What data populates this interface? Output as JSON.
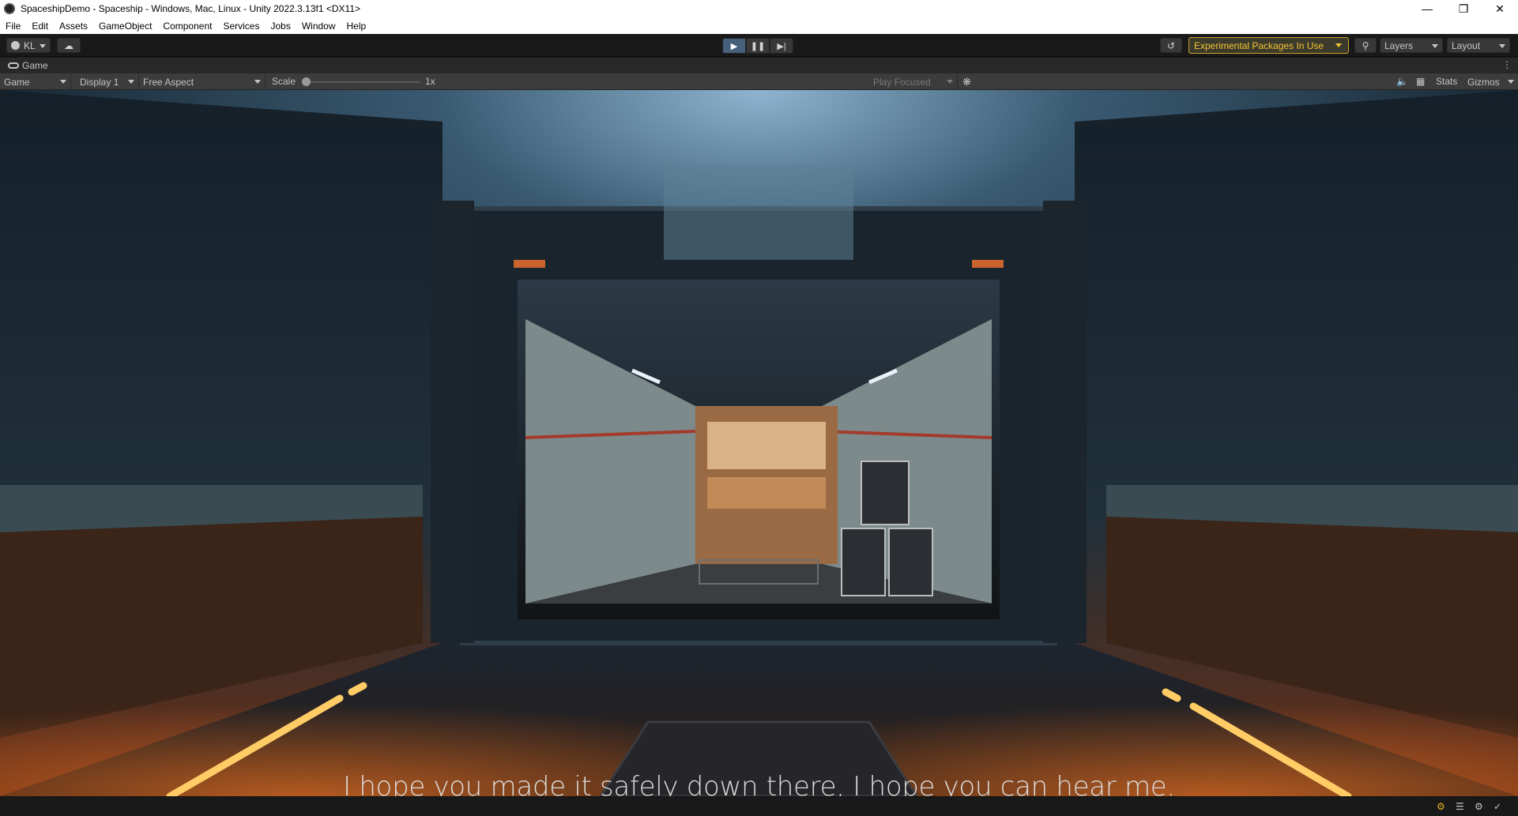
{
  "window": {
    "title": "SpaceshipDemo - Spaceship - Windows, Mac, Linux - Unity 2022.3.13f1 <DX11>",
    "controls": [
      "minimize",
      "restore",
      "close"
    ]
  },
  "menu": [
    "File",
    "Edit",
    "Assets",
    "GameObject",
    "Component",
    "Services",
    "Jobs",
    "Window",
    "Help"
  ],
  "toolbar": {
    "account_label": "KL",
    "experimental_label": "Experimental Packages In Use",
    "layers_label": "Layers",
    "layout_label": "Layout",
    "play_state": "playing"
  },
  "tab": {
    "label": "Game"
  },
  "game_toolbar": {
    "mode": "Game",
    "display": "Display 1",
    "aspect": "Free Aspect",
    "scale_label": "Scale",
    "scale_value": "1x",
    "play_mode": "Play Focused",
    "stats_label": "Stats",
    "gizmos_label": "Gizmos"
  },
  "game_view": {
    "subtitle": "I hope you made it safely down there, I hope you can hear me."
  },
  "colors": {
    "accent": "#f3c53b",
    "play_active": "#46607c",
    "editor_bg": "#191919"
  }
}
